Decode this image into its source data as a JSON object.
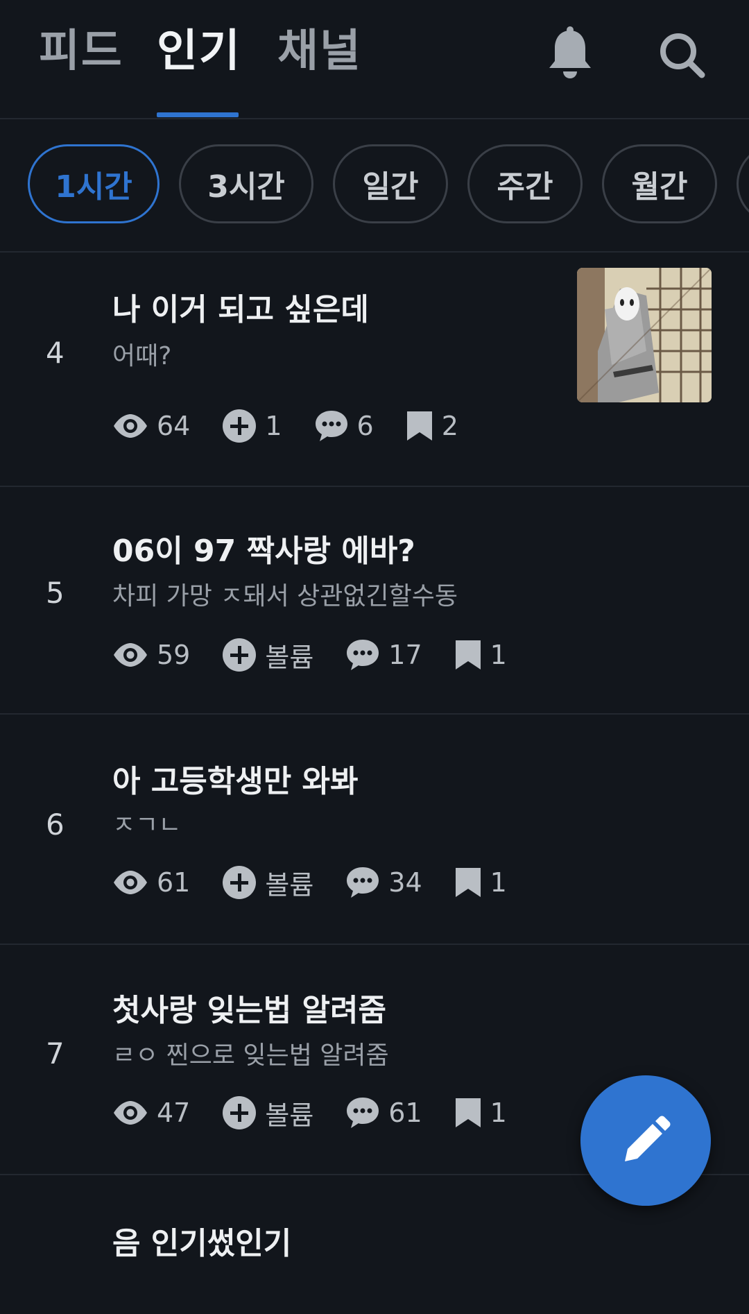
{
  "header": {
    "tabs": [
      {
        "label": "피드",
        "active": false
      },
      {
        "label": "인기",
        "active": true
      },
      {
        "label": "채널",
        "active": false
      }
    ],
    "icons": [
      "bell-icon",
      "search-icon"
    ]
  },
  "filters": [
    {
      "label": "1시간",
      "active": true
    },
    {
      "label": "3시간",
      "active": false
    },
    {
      "label": "일간",
      "active": false
    },
    {
      "label": "주간",
      "active": false
    },
    {
      "label": "월간",
      "active": false
    }
  ],
  "posts": [
    {
      "rank": "4",
      "title": "나 이거 되고 싶은데",
      "excerpt": "어때?",
      "views": "64",
      "volume": "1",
      "comments": "6",
      "bookmarks": "2",
      "has_thumbnail": true
    },
    {
      "rank": "5",
      "title": "06이 97 짝사랑 에바?",
      "excerpt": "차피 가망 ㅈ돼서 상관없긴할수동",
      "views": "59",
      "volume": "볼륨",
      "comments": "17",
      "bookmarks": "1"
    },
    {
      "rank": "6",
      "title": "아 고등학생만 와봐",
      "excerpt": "ㅈㄱㄴ",
      "views": "61",
      "volume": "볼륨",
      "comments": "34",
      "bookmarks": "1"
    },
    {
      "rank": "7",
      "title": "첫사랑 잊는법 알려줌",
      "excerpt": "ㄹㅇ 찐으로 잊는법 알려줌",
      "views": "47",
      "volume": "볼륨",
      "comments": "61",
      "bookmarks": "1"
    },
    {
      "rank": "",
      "title": "음 인기썼인기",
      "excerpt": "",
      "views": "",
      "volume": "",
      "comments": "",
      "bookmarks": ""
    }
  ],
  "colors": {
    "background": "#12161c",
    "accent": "#2f74d0",
    "divider": "#232830",
    "muted_text": "#9aa0a8"
  },
  "fab": {
    "icon": "pencil-icon"
  }
}
